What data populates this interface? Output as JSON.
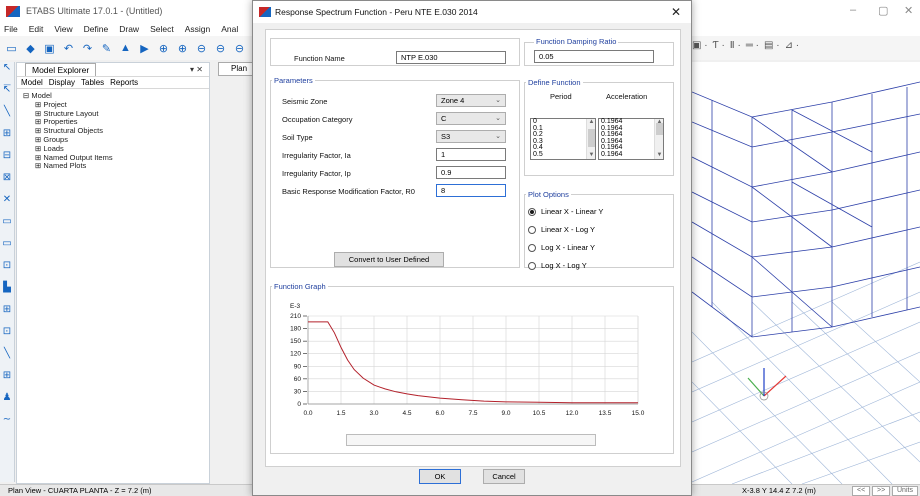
{
  "app": {
    "title": "ETABS Ultimate 17.0.1 - (Untitled)",
    "menu": [
      "File",
      "Edit",
      "View",
      "Define",
      "Draw",
      "Select",
      "Assign",
      "Anal"
    ],
    "window_controls": [
      "–",
      "▢",
      "✕"
    ]
  },
  "toolbar": {
    "icons": [
      "new-model-icon",
      "open-icon",
      "save-icon",
      "undo-icon",
      "redo-icon",
      "pencil-icon",
      "lock-icon",
      "run-icon",
      "zoom-window-icon",
      "zoom-in-icon",
      "zoom-out-icon",
      "zoom-prev-icon",
      "zoom-fit-icon"
    ]
  },
  "explorer": {
    "title": "Model Explorer",
    "pin": "▾ ✕",
    "tabs": [
      "Model",
      "Display",
      "Tables",
      "Reports"
    ],
    "root": "Model",
    "items": [
      "Project",
      "Structure Layout",
      "Properties",
      "Structural Objects",
      "Groups",
      "Loads",
      "Named Output Items",
      "Named Plots"
    ]
  },
  "plan_tab": "Plan",
  "statusbar": {
    "left": "Plan View - CUARTA PLANTA - Z = 7.2 (m)",
    "right": "X-3.8  Y 14.4  Z 7.2 (m)",
    "nav_prev": "<<",
    "nav_next": ">>",
    "units": "Units"
  },
  "dialog": {
    "title": "Response Spectrum Function - Peru NTE E.030 2014",
    "close": "✕",
    "function_name_label": "Function Name",
    "function_name": "NTP E.030",
    "damping_group": "Function Damping Ratio",
    "damping_value": "0.05",
    "parameters_group": "Parameters",
    "params": [
      {
        "label": "Seismic Zone",
        "value": "Zone 4",
        "kind": "select"
      },
      {
        "label": "Occupation Category",
        "value": "C",
        "kind": "select"
      },
      {
        "label": "Soil Type",
        "value": "S3",
        "kind": "select"
      },
      {
        "label": "Irregularity Factor, Ia",
        "value": "1",
        "kind": "input"
      },
      {
        "label": "Irregularity Factor, Ip",
        "value": "0.9",
        "kind": "input"
      },
      {
        "label": "Basic Response Modification Factor, R0",
        "value": "8",
        "kind": "input"
      }
    ],
    "define_group": "Define Function",
    "col_period": "Period",
    "col_accel": "Acceleration",
    "periods": [
      "0",
      "0.1",
      "0.2",
      "0.3",
      "0.4",
      "0.5"
    ],
    "accels": [
      "0.1964",
      "0.1964",
      "0.1964",
      "0.1964",
      "0.1964",
      "0.1964"
    ],
    "plot_group": "Plot Options",
    "plot_options": [
      "Linear X - Linear Y",
      "Linear X - Log Y",
      "Log X - Linear Y",
      "Log X - Log Y"
    ],
    "plot_selected": 0,
    "convert_label": "Convert to User Defined",
    "graph_group": "Function Graph",
    "ok": "OK",
    "cancel": "Cancel"
  },
  "chart_data": {
    "type": "line",
    "title": "",
    "xlabel": "",
    "ylabel": "E-3",
    "xlim": [
      0,
      15
    ],
    "ylim": [
      0,
      210
    ],
    "x_ticks": [
      "0.0",
      "1.5",
      "3.0",
      "4.5",
      "6.0",
      "7.5",
      "9.0",
      "10.5",
      "12.0",
      "13.5",
      "15.0"
    ],
    "y_ticks": [
      "0",
      "30",
      "60",
      "90",
      "120",
      "150",
      "180",
      "210"
    ],
    "grid": true,
    "color": "#b3212b",
    "x": [
      0,
      0.5,
      0.9,
      1.2,
      1.5,
      1.8,
      2.1,
      2.5,
      3.0,
      3.5,
      4.0,
      4.5,
      5.0,
      6.0,
      7.0,
      8.0,
      9.0,
      10.5,
      12.0,
      13.5,
      15.0
    ],
    "y": [
      196,
      196,
      196,
      170,
      135,
      105,
      82,
      62,
      45,
      36,
      29,
      24,
      20,
      14,
      10,
      7,
      5,
      4,
      3,
      3,
      3
    ]
  }
}
